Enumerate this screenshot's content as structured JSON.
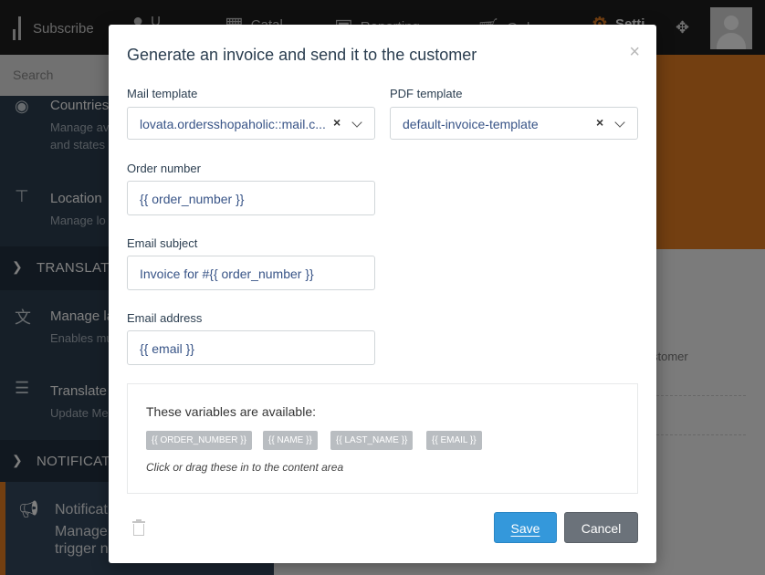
{
  "topbar": {
    "subscribe_label": "Subscribe",
    "user_label": "U",
    "catalog_label": "Catal",
    "reports_label": "Reporting",
    "orders_label": "Ord",
    "settings_label": "Setti"
  },
  "search": {
    "placeholder": "Search"
  },
  "sidebar": {
    "countries": {
      "title": "Countries",
      "desc1": "Manage av",
      "desc2": "and states"
    },
    "location": {
      "title": "Location",
      "desc1": "Manage lo"
    },
    "group_translate": "TRANSLATE",
    "manage_languages": {
      "title": "Manage la",
      "desc1": "Enables mu"
    },
    "translate_messages": {
      "title": "Translate",
      "desc1": "Update Me"
    },
    "group_notifications": "NOTIFICATIO",
    "notifications": {
      "title": "Notificat",
      "desc1": "Manage th",
      "desc2": "trigger no"
    }
  },
  "content": {
    "customer_text": "stomer"
  },
  "modal": {
    "title": "Generate an invoice and send it to the customer",
    "close_symbol": "×",
    "mail_template": {
      "label": "Mail template",
      "value": "lovata.ordersshopaholic::mail.c..."
    },
    "pdf_template": {
      "label": "PDF template",
      "value": "default-invoice-template"
    },
    "order_number": {
      "label": "Order number",
      "value": "{{ order_number }}"
    },
    "email_subject": {
      "label": "Email subject",
      "value": "Invoice for #{{ order_number }}"
    },
    "email_address": {
      "label": "Email address",
      "value": "{{ email }}"
    },
    "variables": {
      "title": "These variables are available:",
      "chips": [
        "{{ ORDER_NUMBER }}",
        "{{ NAME }}",
        "{{ LAST_NAME }}",
        "{{ EMAIL }}"
      ],
      "hint": "Click or drag these in to the content area"
    },
    "save_label": "Save",
    "cancel_label": "Cancel"
  },
  "colors": {
    "accent_orange": "#e67e22",
    "primary_blue": "#3498db",
    "sidebar_bg": "#2c3e50",
    "cancel_gray": "#6b727a"
  }
}
